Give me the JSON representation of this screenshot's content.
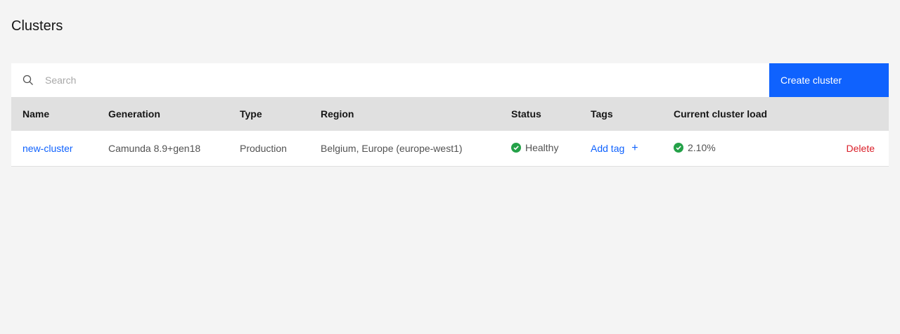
{
  "page": {
    "title": "Clusters"
  },
  "toolbar": {
    "search_placeholder": "Search",
    "search_value": "",
    "create_label": "Create cluster"
  },
  "table": {
    "headers": [
      "Name",
      "Generation",
      "Type",
      "Region",
      "Status",
      "Tags",
      "Current cluster load",
      ""
    ],
    "rows": [
      {
        "name": "new-cluster",
        "generation": "Camunda 8.9+gen18",
        "type": "Production",
        "region": "Belgium, Europe (europe-west1)",
        "status": "Healthy",
        "tags_action": "Add tag",
        "tags_add_icon": "+",
        "load": "2.10%",
        "delete_label": "Delete"
      }
    ]
  },
  "icons": {
    "search": "search-icon",
    "status_ok": "checkmark-filled-icon",
    "load_ok": "checkmark-filled-icon",
    "add_tag": "plus-icon"
  },
  "colors": {
    "accent": "#0f62fe",
    "success": "#24a148",
    "danger": "#da1e28",
    "background": "#f4f4f4",
    "header_bg": "#e0e0e0"
  }
}
